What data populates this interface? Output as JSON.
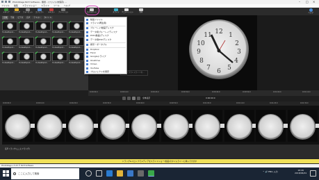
{
  "window": {
    "title": "PhotoStage NCH Software - 無題 - (ファイル未保存) ..."
  },
  "menubar": {
    "items": [
      "ファイル",
      "編集",
      "スライドショー",
      "スライド",
      "ツール",
      "ヘルプ"
    ]
  },
  "toolbar": {
    "buttons": [
      {
        "label": "メディア",
        "color": "#3a8d3a"
      },
      {
        "label": "フォルダ",
        "color": "#e0b030"
      },
      {
        "label": "フォトセット",
        "color": "#8a8a8a"
      },
      {
        "label": "エフェクト",
        "color": "#5a8cd4"
      },
      {
        "label": "テキスト",
        "color": "#c04040"
      },
      {
        "label": "ナレーション",
        "color": "#7a7a7a"
      },
      {
        "label": "エクスポート",
        "color": "#d0d0d0"
      },
      {
        "label": "スライド",
        "color": "#3bb0c8"
      },
      {
        "label": "アニメーション",
        "color": "#e0e0e0"
      },
      {
        "label": "共有",
        "color": "#d0d0d0"
      }
    ],
    "right_label": "ヘルプ"
  },
  "media_tabs": [
    "全体",
    "写真",
    "ビデオ",
    "音声",
    "テキスト",
    "タイトル"
  ],
  "thumbnails": [
    {
      "caption": "Yo-desktopo2..."
    },
    {
      "caption": "Yo-desktopo2..."
    },
    {
      "caption": "Yo-desktopo2..."
    },
    {
      "caption": "Yo-desktopo2..."
    },
    {
      "caption": "Yo-desktopo2..."
    },
    {
      "caption": "Yo-desktopo2..."
    },
    {
      "caption": "Yo-desktopo2..."
    },
    {
      "caption": "Yo-desktopo2..."
    },
    {
      "caption": "Yo-desktopo2..."
    },
    {
      "caption": "Yo-desktopo2..."
    },
    {
      "caption": "Yo-desktopo2..."
    },
    {
      "caption": "Yo-desktopo2..."
    },
    {
      "caption": "Yo-desktopo2..."
    },
    {
      "caption": "Yo-desktopo2..."
    },
    {
      "caption": "Yo-desktopo2..."
    }
  ],
  "dropdown": {
    "items": [
      "動画ファイル",
      "スライド(再生用)",
      "ブルーレイ/動画ディスク",
      "データ用ブルーレイディスク",
      "DVD(動画)ディスク",
      "データ用DVDディスク",
      "携帯・ポータブル",
      "Dropbox",
      "Flickr",
      "Googleドライブ",
      "OneDrive",
      "Vimeo",
      "YouTube",
      "プロジェクトを保存"
    ]
  },
  "preview": {
    "picker_placeholder": "ブラウンスライドを...",
    "transport_label": "全体表示",
    "timecode": "0:00:00:0"
  },
  "scrub_ticks": [
    "0:00:00.0",
    "0:00:10.0",
    "0:00:20.0",
    "0:00:30.0",
    "0:00:40.0",
    "0:00:50.0",
    "0:01:00.0",
    "0:01:10.0"
  ],
  "timeline": {
    "ruler_ticks": [
      "0:00:00.0",
      "0:00:10.0",
      "0:00:20.0",
      "0:00:30.0",
      "0:00:40.0",
      "0:00:50.0",
      "0:01:00.0",
      "0:01:10.0",
      "0:01:20.0",
      "0:01:30.0"
    ],
    "frame_count": 10,
    "track2_label": "音声トラック(ここにドラッグ)"
  },
  "status": {
    "yellow_message": "ドラッグ&ドロップでメディアをスライドショー(動画)のタイムラインに挿入できます",
    "statusline": "PhotoStage v 5.15 © NCH Software"
  },
  "taskbar": {
    "search_placeholder": "ここに入力して検索",
    "tray": "^ 🔊 ENG 入力",
    "time": "16:49",
    "date": "2018/06/01"
  }
}
